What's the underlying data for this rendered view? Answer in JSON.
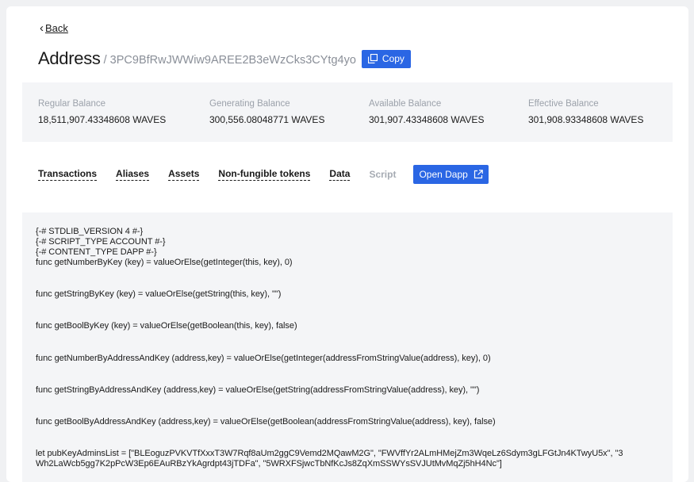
{
  "nav": {
    "back_label": "Back"
  },
  "header": {
    "title": "Address",
    "address": "/ 3PC9BfRwJWWiw9AREE2B3eWzCks3CYtg4yo",
    "copy_label": "Copy"
  },
  "balances": [
    {
      "label": "Regular Balance",
      "value": "18,511,907.43348608 WAVES"
    },
    {
      "label": "Generating Balance",
      "value": "300,556.08048771 WAVES"
    },
    {
      "label": "Available Balance",
      "value": "301,907.43348608 WAVES"
    },
    {
      "label": "Effective Balance",
      "value": "301,908.93348608 WAVES"
    }
  ],
  "tabs": [
    {
      "label": "Transactions"
    },
    {
      "label": "Aliases"
    },
    {
      "label": "Assets"
    },
    {
      "label": "Non-fungible tokens"
    },
    {
      "label": "Data"
    },
    {
      "label": "Script"
    }
  ],
  "open_dapp_label": "Open Dapp",
  "code_lines": [
    "{-# STDLIB_VERSION 4 #-}",
    "{-# SCRIPT_TYPE ACCOUNT #-}",
    "{-# CONTENT_TYPE DAPP #-}",
    "func getNumberByKey (key) = valueOrElse(getInteger(this, key), 0)",
    "func getStringByKey (key) = valueOrElse(getString(this, key), \"\")",
    "func getBoolByKey (key) = valueOrElse(getBoolean(this, key), false)",
    "func getNumberByAddressAndKey (address,key) = valueOrElse(getInteger(addressFromStringValue(address), key), 0)",
    "func getStringByAddressAndKey (address,key) = valueOrElse(getString(addressFromStringValue(address), key), \"\")",
    "func getBoolByAddressAndKey (address,key) = valueOrElse(getBoolean(addressFromStringValue(address), key), false)",
    "let pubKeyAdminsList = [\"BLEoguzPVKVTfXxxT3W7Rqf8aUm2ggC9Vemd2MQawM2G\", \"FWVffYr2ALmHMejZm3WqeLz6Sdym3gLFGtJn4KTwyU5x\", \"3",
    "Wh2LaWcb5gg7K2pPcW3Ep6EAuRBzYkAgrdpt43jTDFa\", \"5WRXFSjwcTbNfKcJs8ZqXmSSWYsSVJUtMvMqZj5hH4Nc\"]"
  ],
  "colors": {
    "accent": "#2a66e4",
    "muted": "#9ba1aa",
    "panel": "#f4f5f7"
  }
}
